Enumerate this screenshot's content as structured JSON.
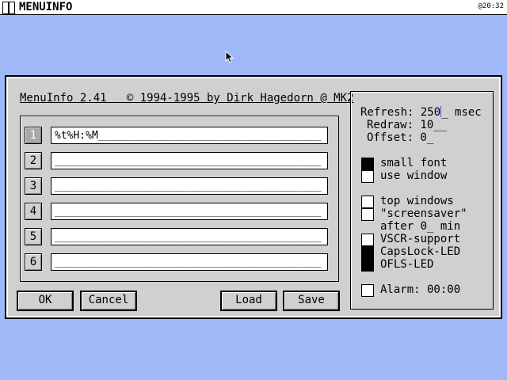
{
  "menubar": {
    "title": "MENUINFO",
    "clock": "@20:32"
  },
  "dialog": {
    "app_title": "MenuInfo 2.41   © 1994-1995 by Dirk Hagedorn @ MK2",
    "fields": [
      {
        "num": "1",
        "value": "%t%H:%M____________________________________"
      },
      {
        "num": "2",
        "value": "___________________________________________"
      },
      {
        "num": "3",
        "value": "___________________________________________"
      },
      {
        "num": "4",
        "value": "___________________________________________"
      },
      {
        "num": "5",
        "value": "___________________________________________"
      },
      {
        "num": "6",
        "value": "___________________________________________"
      }
    ],
    "buttons": {
      "ok": "OK",
      "cancel": "Cancel",
      "load": "Load",
      "save": "Save"
    },
    "settings": {
      "refresh_label": "Refresh: ",
      "refresh_value": "250",
      "refresh_rest": "_ msec",
      "redraw": "Redraw: 10__",
      "offset": "Offset: 0_",
      "small_font": "small font",
      "use_window": "use window",
      "top_windows": "top windows",
      "screensaver": "\"screensaver\"",
      "after": "after 0_ min",
      "vscr": "VSCR-support",
      "capslock": "CapsLock-LED",
      "ofls": "OFLS-LED",
      "alarm": "Alarm: 00:00"
    }
  }
}
